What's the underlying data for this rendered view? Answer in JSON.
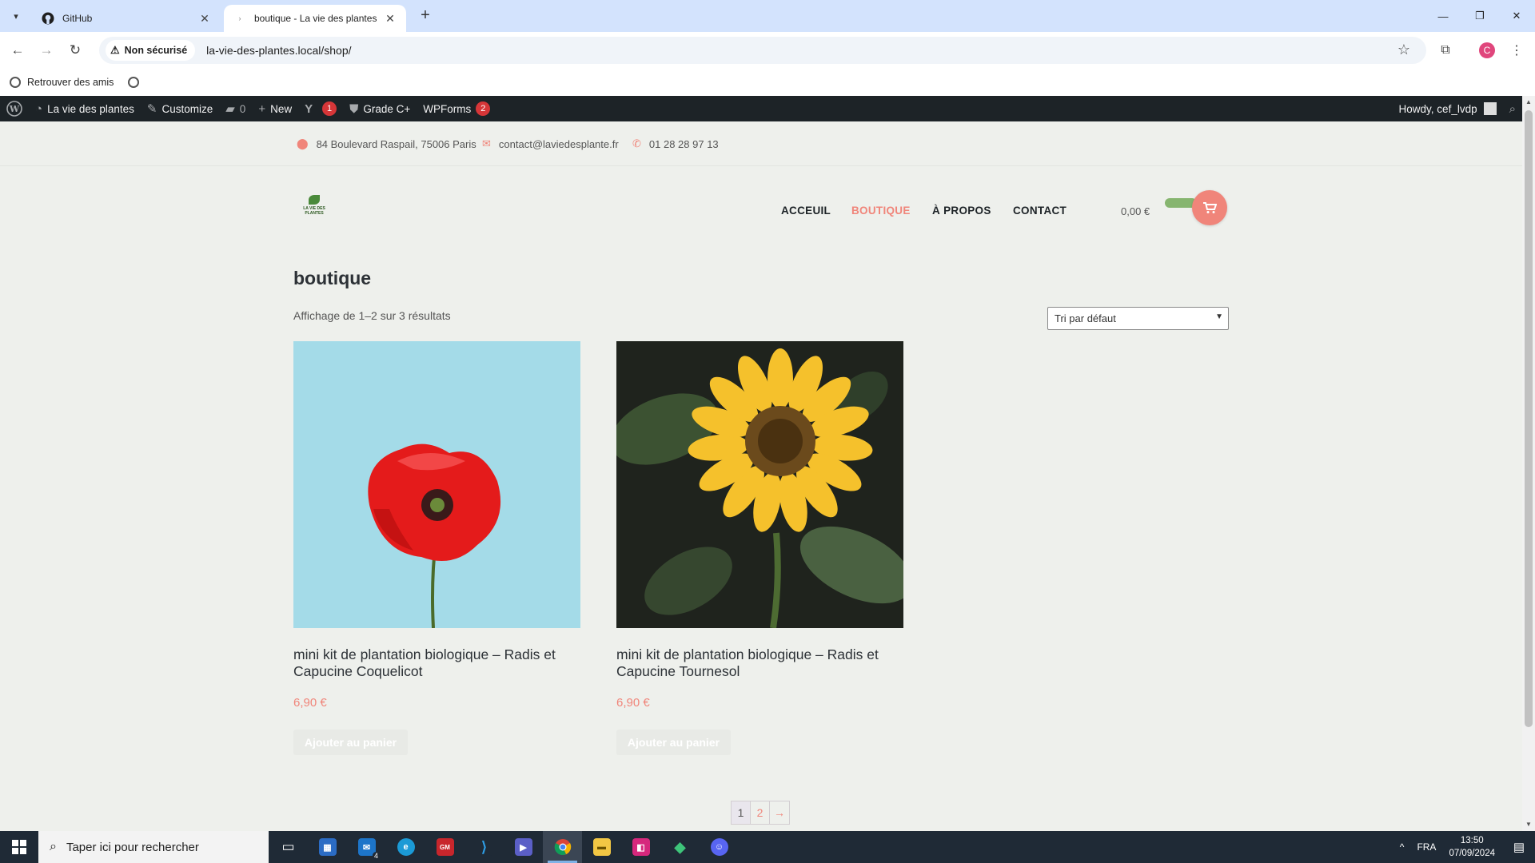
{
  "browser": {
    "tabs": [
      {
        "title": "GitHub",
        "icon": "github-icon"
      },
      {
        "title": "boutique - La vie des plantes",
        "icon": "site-favicon"
      }
    ],
    "security_label": "Non sécurisé",
    "url": "la-vie-des-plantes.local/shop/",
    "profile_initial": "C",
    "bookmarks": [
      "Retrouver des amis"
    ]
  },
  "adminbar": {
    "site_name": "La vie des plantes",
    "customize": "Customize",
    "comments_count": "0",
    "new": "New",
    "yoast_count": "1",
    "grade": "Grade C+",
    "wpforms": "WPForms",
    "wpforms_count": "2",
    "howdy": "Howdy, cef_lvdp"
  },
  "topinfo": {
    "address": "84 Boulevard Raspail, 75006 Paris",
    "email": "contact@laviedesplante.fr",
    "phone": "01 28 28 97 13"
  },
  "header": {
    "logo_text": "LA VIE DES PLANTES",
    "nav": [
      "ACCEUIL",
      "BOUTIQUE",
      "À PROPOS",
      "CONTACT"
    ],
    "current_nav": "BOUTIQUE",
    "cart_total": "0,00 €"
  },
  "shop": {
    "title": "boutique",
    "result_count": "Affichage de 1–2 sur 3 résultats",
    "ordering": "Tri par défaut",
    "products": [
      {
        "name": "mini kit de plantation biologique – Radis et Capucine Coquelicot",
        "price": "6,90 €",
        "button": "Ajouter au panier",
        "image": "red poppy on light blue background"
      },
      {
        "name": "mini kit de plantation biologique – Radis et Capucine Tournesol",
        "price": "6,90 €",
        "button": "Ajouter au panier",
        "image": "yellow sunflower on dark background"
      }
    ],
    "pagination": [
      "1",
      "2",
      "→"
    ],
    "current_page": "1"
  },
  "taskbar": {
    "search_placeholder": "Taper ici pour rechercher",
    "mail_badge": "4",
    "language": "FRA",
    "time": "13:50",
    "date": "07/09/2024"
  },
  "colors": {
    "accent": "#f0857a",
    "green": "#86b56f",
    "adminbar": "#1d2327",
    "page_bg": "#eef0ec"
  }
}
